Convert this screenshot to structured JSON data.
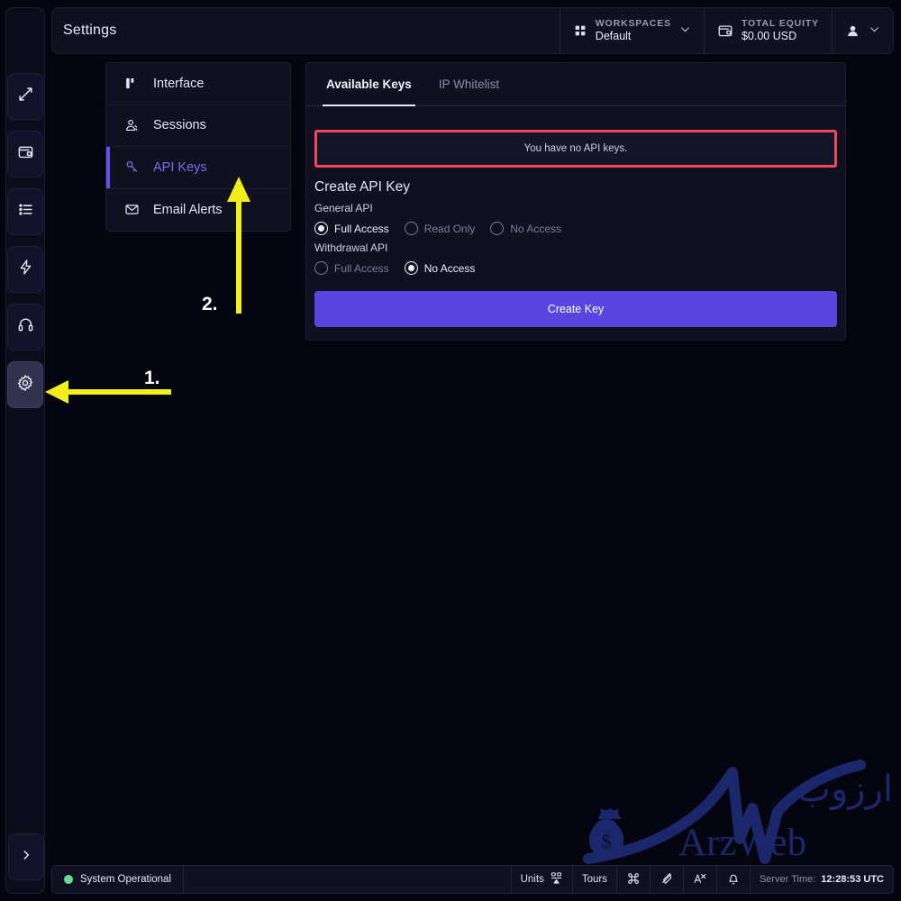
{
  "header": {
    "title": "Settings",
    "workspaces": {
      "label": "WORKSPACES",
      "value": "Default",
      "icon": "grid-icon",
      "chevron": "⌄"
    },
    "equity": {
      "label": "TOTAL EQUITY",
      "value": "$0.00 USD",
      "icon": "wallet-icon"
    },
    "account": {
      "icon": "user-icon",
      "chevron": "⌄"
    }
  },
  "rail": {
    "items": [
      {
        "icon": "transfer-arrows-icon",
        "name": "trade"
      },
      {
        "icon": "wallet-icon",
        "name": "wallet"
      },
      {
        "icon": "list-icon",
        "name": "orders"
      },
      {
        "icon": "lightning-icon",
        "name": "rewards"
      },
      {
        "icon": "headset-icon",
        "name": "support"
      },
      {
        "icon": "gear-icon",
        "name": "settings"
      }
    ],
    "expand_icon": "chevron-right-icon"
  },
  "settings_nav": {
    "items": [
      {
        "label": "Interface",
        "icon": "layout-icon",
        "active": false
      },
      {
        "label": "Sessions",
        "icon": "user-sessions-icon",
        "active": false
      },
      {
        "label": "API Keys",
        "icon": "key-icon",
        "active": true
      },
      {
        "label": "Email Alerts",
        "icon": "envelope-icon",
        "active": false
      }
    ]
  },
  "panel": {
    "tabs": [
      {
        "label": "Available Keys",
        "active": true
      },
      {
        "label": "IP Whitelist",
        "active": false
      }
    ],
    "empty_message": "You have no API keys.",
    "form_title": "Create API Key",
    "groups": [
      {
        "label": "General API",
        "options": [
          {
            "label": "Full Access",
            "selected": true
          },
          {
            "label": "Read Only",
            "selected": false
          },
          {
            "label": "No Access",
            "selected": false
          }
        ]
      },
      {
        "label": "Withdrawal API",
        "options": [
          {
            "label": "Full Access",
            "selected": false
          },
          {
            "label": "No Access",
            "selected": true
          }
        ]
      }
    ],
    "submit_label": "Create Key"
  },
  "statusbar": {
    "system_status": "System Operational",
    "units_label": "Units",
    "units_icon": "units-icon",
    "tours_label": "Tours",
    "icons": [
      {
        "name": "command-shortcut-icon"
      },
      {
        "name": "theme-ink-icon"
      },
      {
        "name": "language-translate-icon"
      },
      {
        "name": "bell-notification-icon"
      }
    ],
    "server_time_label": "Server Time:",
    "server_time_value": "12:28:53 UTC"
  },
  "annotations": [
    {
      "number": "1.",
      "target": "settings-rail-button"
    },
    {
      "number": "2.",
      "target": "api-keys-nav-item"
    }
  ],
  "watermark": {
    "farsi": "ارزوب",
    "latin": "ArzWeb"
  },
  "colors": {
    "accent_purple": "#5b45e0",
    "active_nav_purple": "#7b6cf0",
    "error_red": "#f0475c",
    "status_green": "#67dd96",
    "annotation_yellow": "#f2ee1a",
    "panel_bg": "#101020",
    "app_bg": "#05050f"
  }
}
